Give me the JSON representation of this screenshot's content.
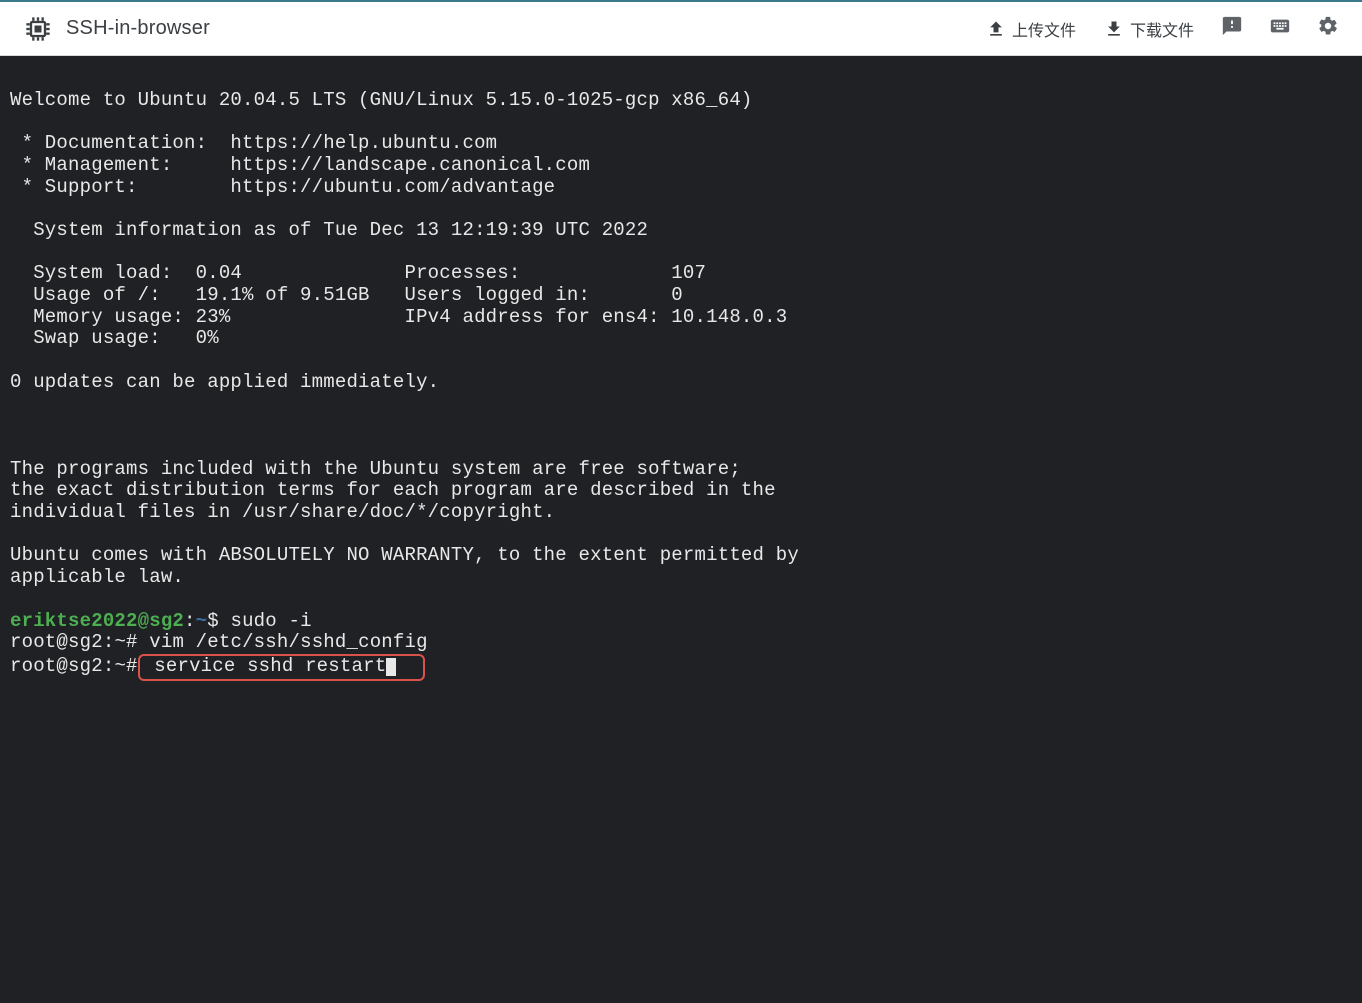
{
  "header": {
    "title": "SSH-in-browser",
    "upload_label": "上传文件",
    "download_label": "下载文件"
  },
  "terminal": {
    "welcome": "Welcome to Ubuntu 20.04.5 LTS (GNU/Linux 5.15.0-1025-gcp x86_64)",
    "blank": "",
    "doc_line": " * Documentation:  https://help.ubuntu.com",
    "mgmt_line": " * Management:     https://landscape.canonical.com",
    "support_line": " * Support:        https://ubuntu.com/advantage",
    "sysinfo_header": "  System information as of Tue Dec 13 12:19:39 UTC 2022",
    "sys_load": "  System load:  0.04              Processes:             107",
    "usage": "  Usage of /:   19.1% of 9.51GB   Users logged in:       0",
    "mem": "  Memory usage: 23%               IPv4 address for ens4: 10.148.0.3",
    "swap": "  Swap usage:   0%",
    "updates": "0 updates can be applied immediately.",
    "prog1": "The programs included with the Ubuntu system are free software;",
    "prog2": "the exact distribution terms for each program are described in the",
    "prog3": "individual files in /usr/share/doc/*/copyright.",
    "warr1": "Ubuntu comes with ABSOLUTELY NO WARRANTY, to the extent permitted by",
    "warr2": "applicable law.",
    "p1_user": "eriktse2022@sg2",
    "p1_colon": ":",
    "p1_path": "~",
    "p1_sym": "$ ",
    "p1_cmd": "sudo -i",
    "p2_user": "root@sg2",
    "p2_colon": ":",
    "p2_path": "~",
    "p2_sym": "# ",
    "p2_cmd": "vim /etc/ssh/sshd_config",
    "p3_user": "root@sg2",
    "p3_colon": ":",
    "p3_path": "~",
    "p3_sym": "#",
    "p3_cmd": " service sshd restart"
  }
}
